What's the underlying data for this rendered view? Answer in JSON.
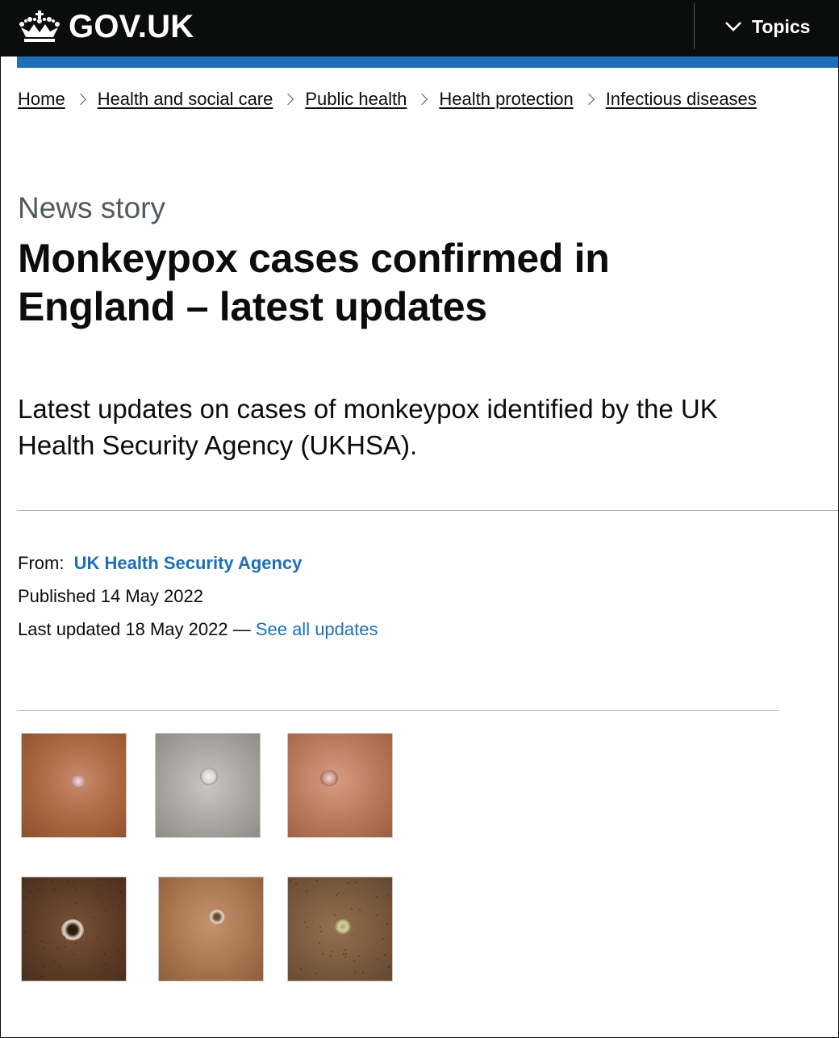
{
  "header": {
    "logo_text": "GOV.UK",
    "menu_label": "Topics",
    "icons": [
      "crown-icon",
      "chevron-down-icon"
    ],
    "colors": {
      "header_bg": "#0b0c0c",
      "accent_bar": "#1d70b8"
    }
  },
  "breadcrumb": [
    {
      "label": "Home"
    },
    {
      "label": "Health and social care"
    },
    {
      "label": "Public health"
    },
    {
      "label": "Health protection"
    },
    {
      "label": "Infectious diseases"
    }
  ],
  "article": {
    "caption": "News story",
    "title": "Monkeypox cases confirmed in England – latest updates",
    "lead": "Latest updates on cases of monkeypox identified by the UK Health Security Agency (UKHSA)."
  },
  "metadata": {
    "from_label": "From:",
    "from_org": "UK Health Security Agency",
    "published_label": "Published",
    "published_date": "14 May 2022",
    "updated_label": "Last updated",
    "updated_date": "18 May 2022",
    "separator": "—",
    "see_all_updates": "See all updates",
    "link_color": "#1d70b8"
  },
  "images": {
    "count": 6,
    "items": [
      "lesion-photo",
      "lesion-photo",
      "lesion-photo",
      "lesion-photo",
      "lesion-photo",
      "lesion-photo"
    ]
  }
}
